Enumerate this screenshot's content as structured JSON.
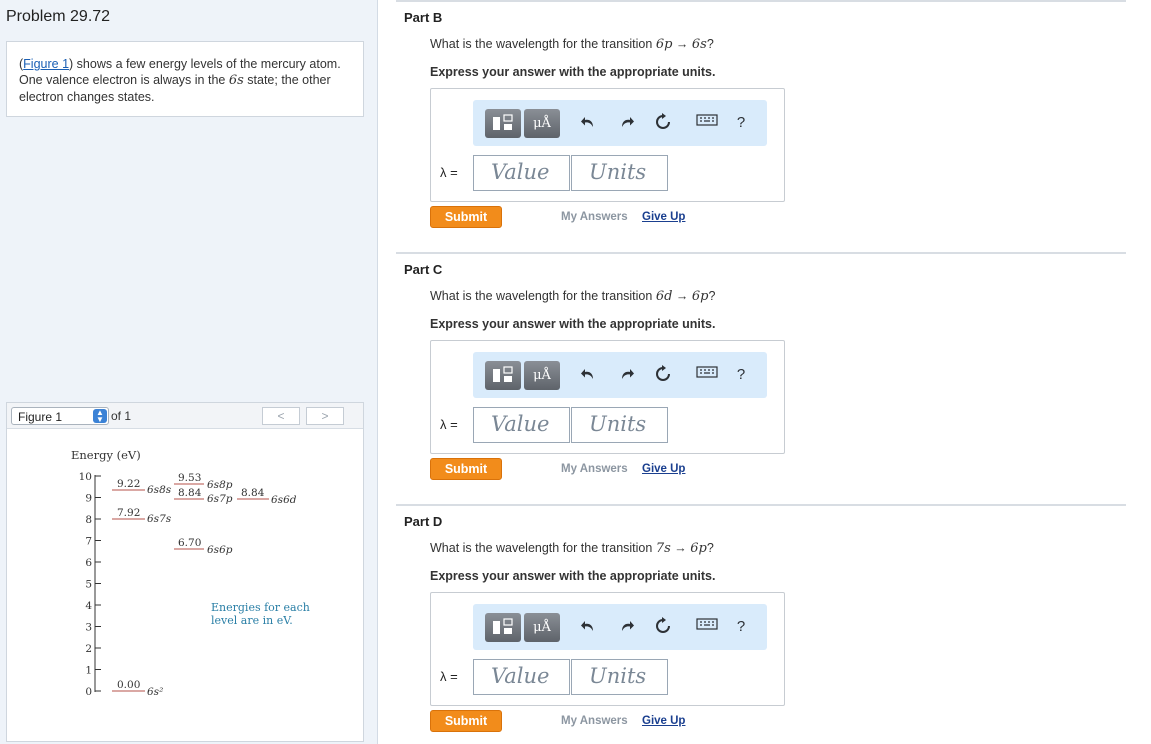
{
  "problem": {
    "title": "Problem 29.72",
    "intro_link": "Figure 1",
    "intro_text_1": ") shows a few energy levels of the mercury atom. One valence electron is always in the ",
    "intro_state": "6s",
    "intro_text_2": " state; the other electron changes states."
  },
  "figure_panel": {
    "select_label": "Figure 1",
    "of_label": "of 1",
    "prev_icon": "chevron-left",
    "next_icon": "chevron-right",
    "y_axis_title": "Energy (eV)",
    "y_ticks": [
      "10",
      "9",
      "8",
      "7",
      "6",
      "5",
      "4",
      "3",
      "2",
      "1",
      "0"
    ],
    "note_line1": "Energies for each",
    "note_line2": "level are in eV.",
    "levels": [
      {
        "value": "9.22",
        "label": "6s8s"
      },
      {
        "value": "7.92",
        "label": "6s7s"
      },
      {
        "value": "0.00",
        "label": "6s²"
      },
      {
        "value": "9.53",
        "label": "6s8p"
      },
      {
        "value": "8.84",
        "label": "6s7p"
      },
      {
        "value": "6.70",
        "label": "6s6p"
      },
      {
        "value": "8.84",
        "label": "6s6d"
      }
    ]
  },
  "parts": [
    {
      "title": "Part B",
      "question_prefix": "What is the wavelength for the transition ",
      "from": "6p",
      "arrow": "→",
      "to": "6s",
      "question_suffix": "?",
      "instruction": "Express your answer with the appropriate units.",
      "lambda_label": "λ =",
      "value_placeholder": "Value",
      "units_placeholder": "Units",
      "submit": "Submit",
      "my_answers": "My Answers",
      "give_up": "Give Up"
    },
    {
      "title": "Part C",
      "question_prefix": "What is the wavelength for the transition ",
      "from": "6d",
      "arrow": "→",
      "to": "6p",
      "question_suffix": "?",
      "instruction": "Express your answer with the appropriate units.",
      "lambda_label": "λ =",
      "value_placeholder": "Value",
      "units_placeholder": "Units",
      "submit": "Submit",
      "my_answers": "My Answers",
      "give_up": "Give Up"
    },
    {
      "title": "Part D",
      "question_prefix": "What is the wavelength for the transition ",
      "from": "7s",
      "arrow": "→",
      "to": "6p",
      "question_suffix": "?",
      "instruction": "Express your answer with the appropriate units.",
      "lambda_label": "λ =",
      "value_placeholder": "Value",
      "units_placeholder": "Units",
      "submit": "Submit",
      "my_answers": "My Answers",
      "give_up": "Give Up"
    }
  ],
  "toolbar": {
    "units_button": "μÅ",
    "undo_icon": "undo-icon",
    "redo_icon": "redo-icon",
    "reset_icon": "reset-icon",
    "keyboard_icon": "keyboard-icon",
    "help": "?"
  },
  "colors": {
    "submit": "#f28c1b",
    "link": "#1a3f8f",
    "toolbar_bg": "#d9ebfb",
    "level_line": "#b5524a",
    "note_text": "#2a7fa6"
  }
}
